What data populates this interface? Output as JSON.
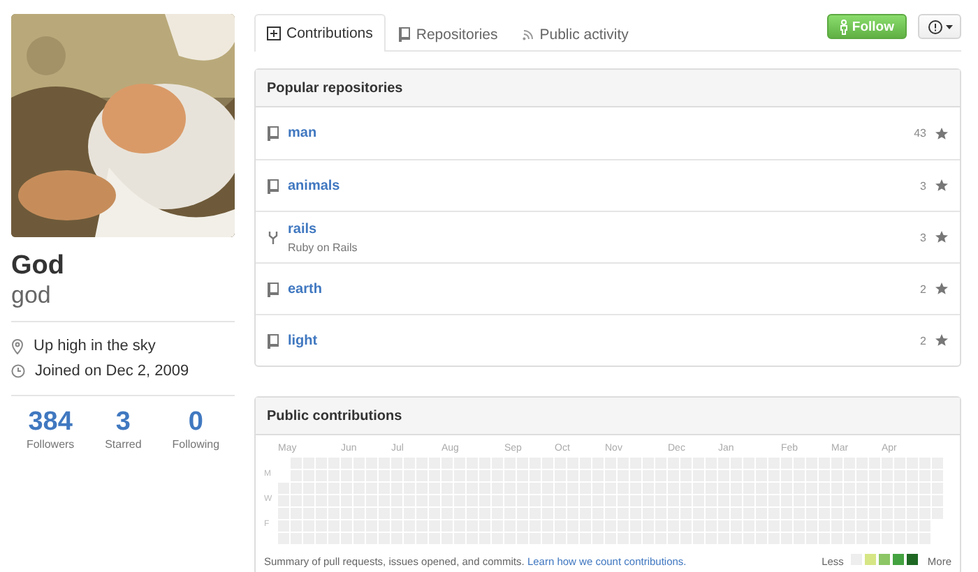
{
  "profile": {
    "name": "God",
    "username": "god",
    "details": [
      {
        "kind": "location",
        "text": "Up high in the sky"
      },
      {
        "kind": "joined",
        "text": "Joined on Dec 2, 2009"
      }
    ],
    "stats": [
      {
        "value": "384",
        "label": "Followers"
      },
      {
        "value": "3",
        "label": "Starred"
      },
      {
        "value": "0",
        "label": "Following"
      }
    ]
  },
  "tabs": [
    {
      "kind": "contributions",
      "label": "Contributions",
      "selected": true
    },
    {
      "kind": "repositories",
      "label": "Repositories",
      "selected": false
    },
    {
      "kind": "activity",
      "label": "Public activity",
      "selected": false
    }
  ],
  "actions": {
    "follow": "Follow"
  },
  "popular_repositories": {
    "title": "Popular repositories",
    "items": [
      {
        "kind": "repo",
        "name": "man",
        "stars_count": "43"
      },
      {
        "kind": "repo",
        "name": "animals",
        "stars_count": "3"
      },
      {
        "kind": "fork",
        "name": "rails",
        "description": "Ruby on Rails",
        "stars_count": "3"
      },
      {
        "kind": "repo",
        "name": "earth",
        "stars_count": "2"
      },
      {
        "kind": "repo",
        "name": "light",
        "stars_count": "2"
      }
    ]
  },
  "public_contributions": {
    "title": "Public contributions",
    "months": [
      "May",
      "Jun",
      "Jul",
      "Aug",
      "Sep",
      "Oct",
      "Nov",
      "Dec",
      "Jan",
      "Feb",
      "Mar",
      "Apr"
    ],
    "days": [
      "M",
      "W",
      "F"
    ],
    "summary": "Summary of pull requests, issues opened, and commits.",
    "link": "Learn how we count contributions.",
    "legend": {
      "less": "Less",
      "more": "More",
      "swatches": [
        {
          "color": "#eeeeee"
        },
        {
          "color": "#d6e685"
        },
        {
          "color": "#8cc665"
        },
        {
          "color": "#44a340"
        },
        {
          "color": "#1e6823"
        }
      ]
    }
  }
}
